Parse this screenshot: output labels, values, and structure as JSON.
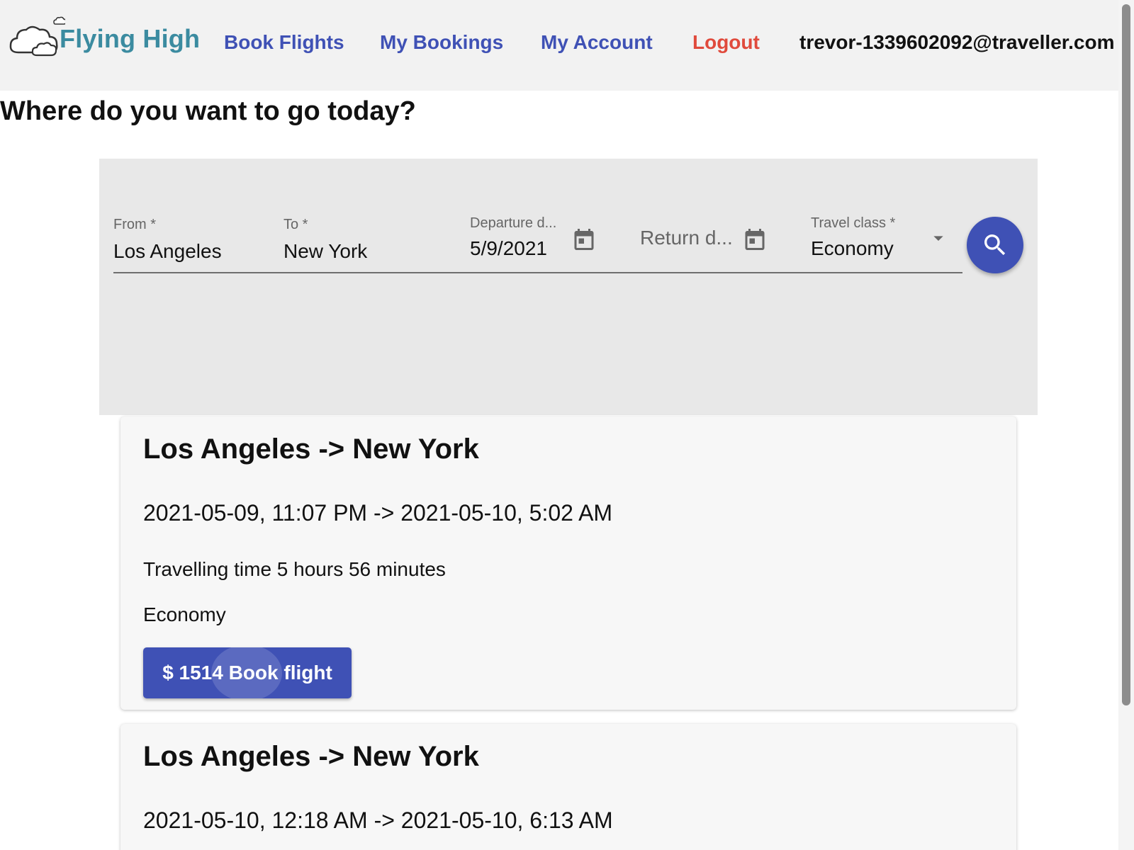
{
  "header": {
    "logo_text": "Flying High",
    "nav": {
      "book_flights": "Book Flights",
      "my_bookings": "My Bookings",
      "my_account": "My Account",
      "logout": "Logout"
    },
    "user_email": "trevor-1339602092@traveller.com"
  },
  "page": {
    "title": "Where do you want to go today?"
  },
  "search": {
    "from_label": "From *",
    "from_value": "Los Angeles",
    "to_label": "To *",
    "to_value": "New York",
    "departure_label": "Departure d...",
    "departure_value": "5/9/2021",
    "return_placeholder": "Return d...",
    "class_label": "Travel class *",
    "class_value": "Economy",
    "icons": {
      "calendar": "calendar-icon",
      "dropdown": "arrow-drop-down-icon",
      "search": "search-icon"
    }
  },
  "flights": [
    {
      "route": "Los Angeles -> New York",
      "times": "2021-05-09, 11:07 PM -> 2021-05-10, 5:02 AM",
      "duration": "Travelling time 5 hours 56 minutes",
      "class": "Economy",
      "book_label": "$ 1514 Book flight"
    },
    {
      "route": "Los Angeles -> New York",
      "times": "2021-05-10, 12:18 AM -> 2021-05-10, 6:13 AM"
    }
  ],
  "colors": {
    "primary": "#3f51b5",
    "logout": "#e04a3c",
    "logo": "#3b8ba0",
    "header_bg": "#f2f2f2",
    "panel_bg": "#e8e8e8",
    "card_bg": "#f7f7f7"
  }
}
